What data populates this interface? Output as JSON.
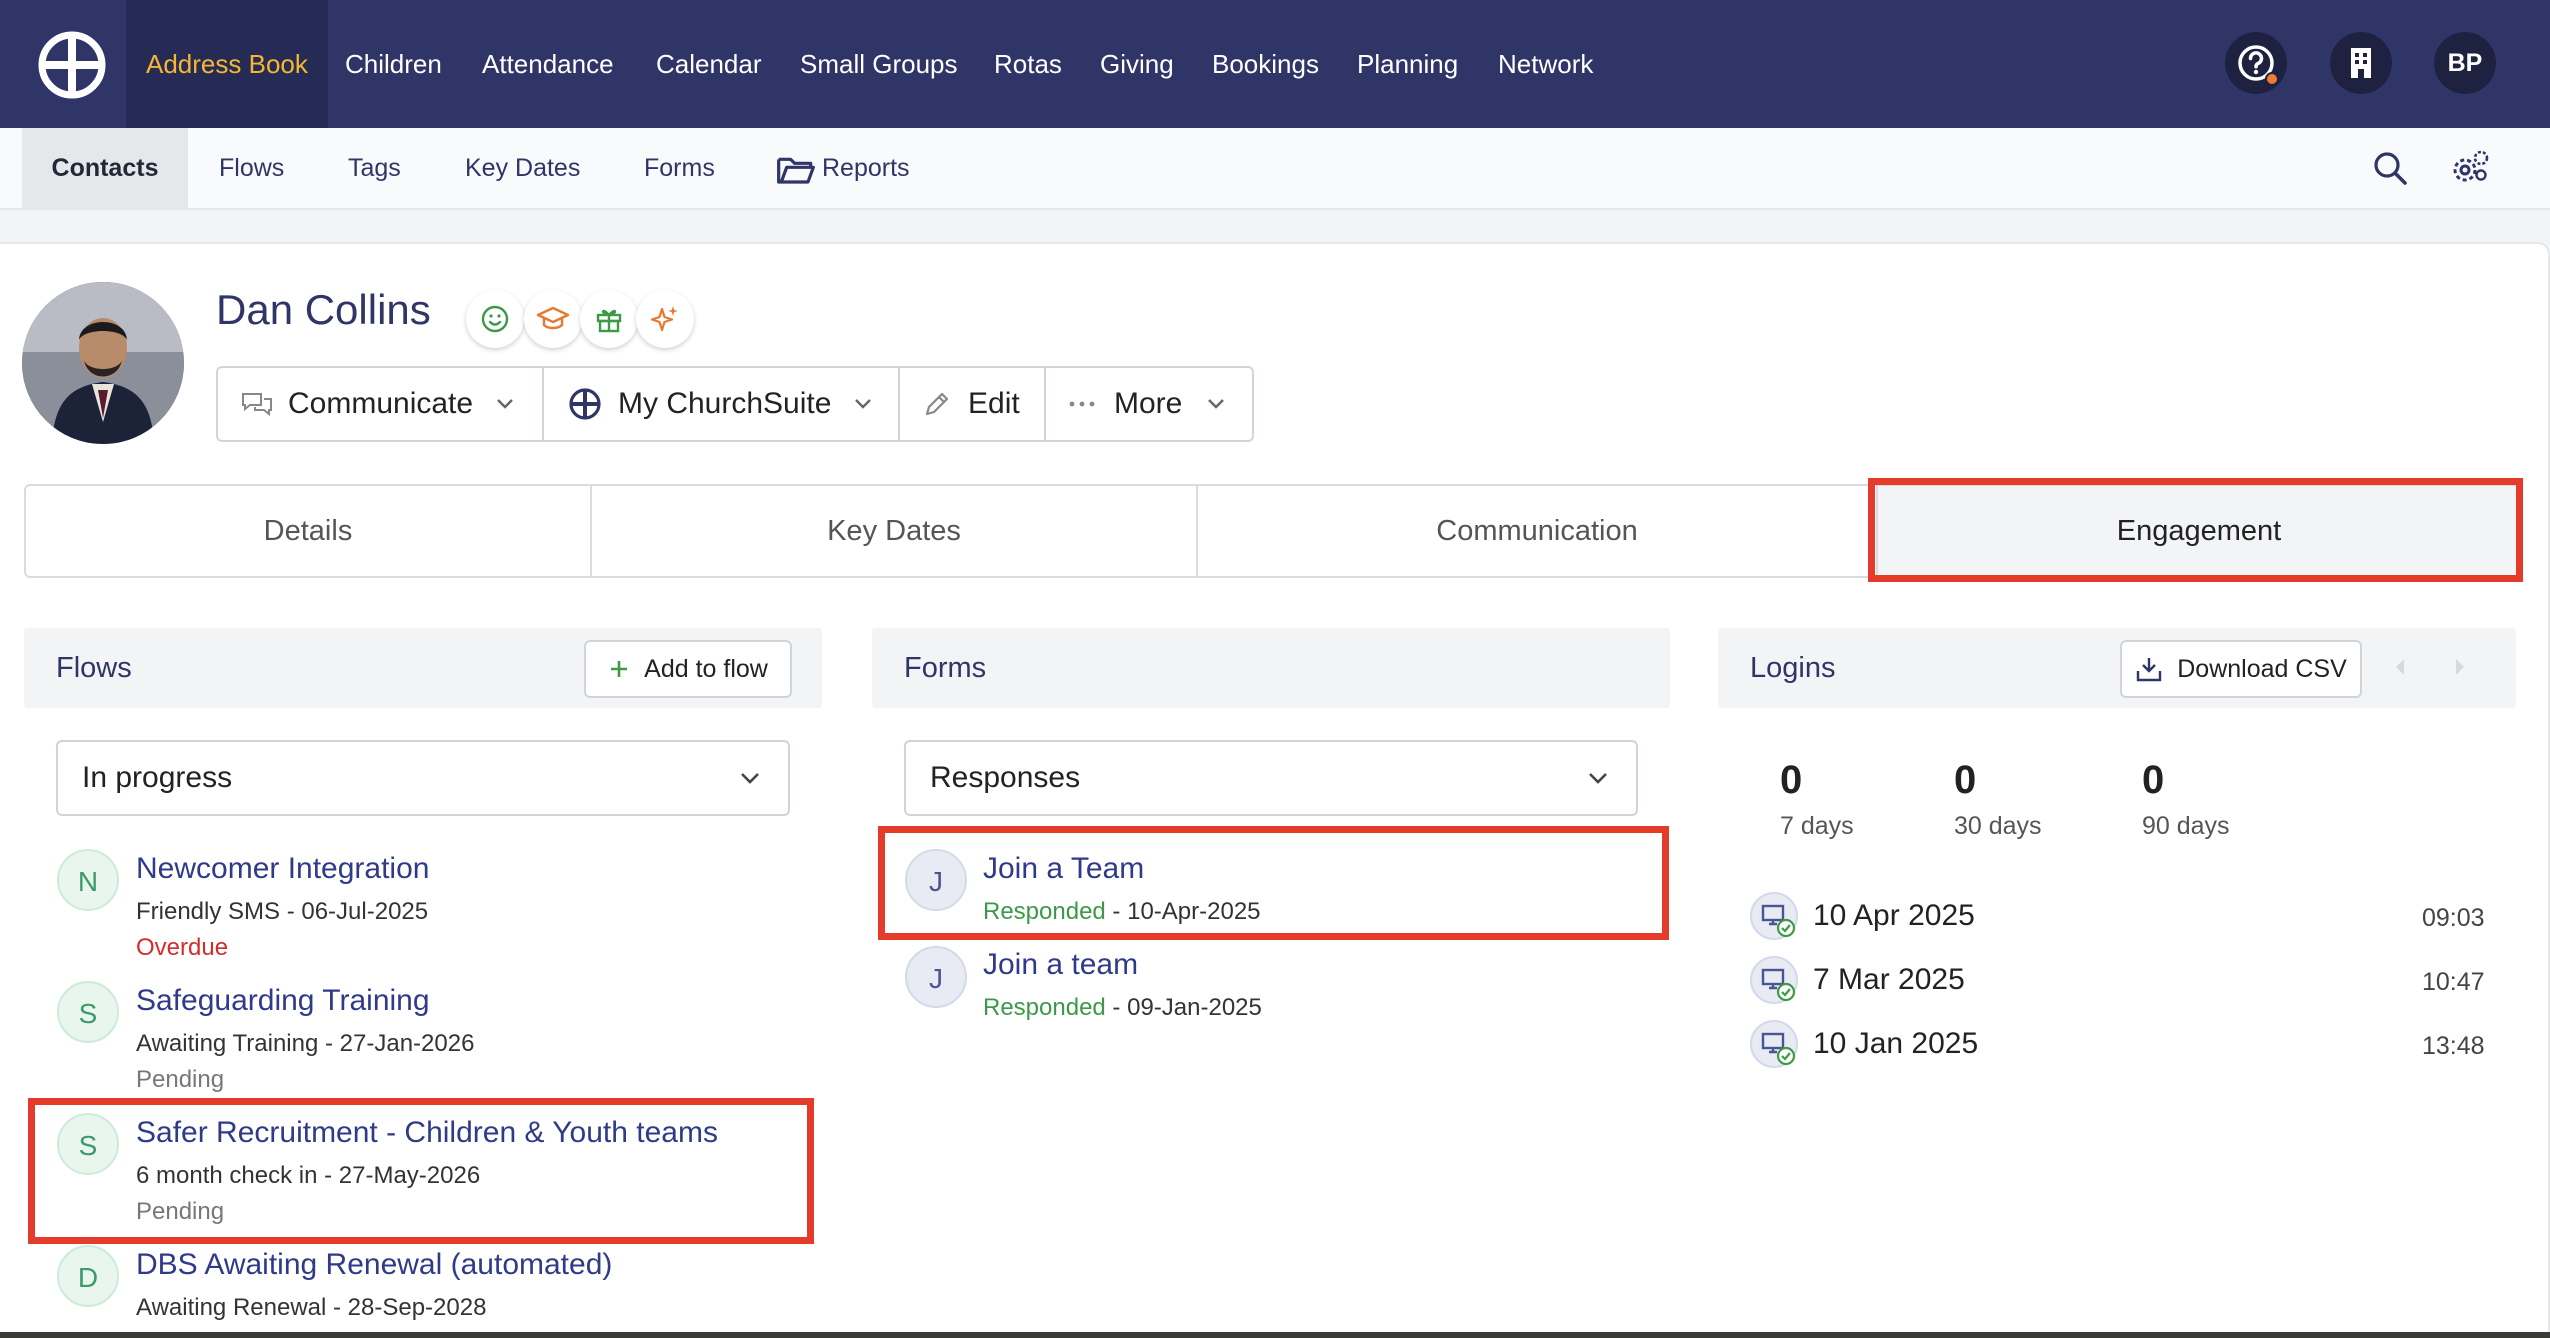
{
  "topnav": {
    "items": [
      {
        "label": "Address Book"
      },
      {
        "label": "Children"
      },
      {
        "label": "Attendance"
      },
      {
        "label": "Calendar"
      },
      {
        "label": "Small Groups"
      },
      {
        "label": "Rotas"
      },
      {
        "label": "Giving"
      },
      {
        "label": "Bookings"
      },
      {
        "label": "Planning"
      },
      {
        "label": "Network"
      }
    ],
    "active_color": "#f5b731",
    "background": "#2f3566",
    "user_initials": "BP",
    "icons": [
      "help-icon",
      "organisation-icon"
    ]
  },
  "subnav": {
    "items": [
      {
        "label": "Contacts"
      },
      {
        "label": "Flows"
      },
      {
        "label": "Tags"
      },
      {
        "label": "Key Dates"
      },
      {
        "label": "Forms"
      },
      {
        "label": "Reports"
      }
    ],
    "icons": [
      "search-icon",
      "settings-icon"
    ]
  },
  "contact": {
    "name": "Dan Collins",
    "badges": [
      "smile-icon",
      "graduation-cap-icon",
      "gift-icon",
      "sparkle-icon"
    ],
    "actions": {
      "communicate": "Communicate",
      "my_churchsuite": "My ChurchSuite",
      "edit": "Edit",
      "more": "More"
    }
  },
  "tabs": [
    {
      "label": "Details"
    },
    {
      "label": "Key Dates"
    },
    {
      "label": "Communication"
    },
    {
      "label": "Engagement"
    }
  ],
  "flows": {
    "title": "Flows",
    "add_label": "Add to flow",
    "filter": "In progress",
    "items": [
      {
        "initial": "N",
        "title": "Newcomer Integration",
        "detail": "Friendly SMS - 06-Jul-2025",
        "status": "Overdue"
      },
      {
        "initial": "S",
        "title": "Safeguarding Training",
        "detail": "Awaiting Training - 27-Jan-2026",
        "status": "Pending"
      },
      {
        "initial": "S",
        "title": "Safer Recruitment - Children & Youth teams",
        "detail": "6 month check in - 27-May-2026",
        "status": "Pending"
      },
      {
        "initial": "D",
        "title": "DBS Awaiting Renewal (automated)",
        "detail": "Awaiting Renewal - 28-Sep-2028",
        "status": ""
      }
    ]
  },
  "forms": {
    "title": "Forms",
    "filter": "Responses",
    "items": [
      {
        "initial": "J",
        "title": "Join a Team",
        "state": "Responded",
        "date": " - 10-Apr-2025"
      },
      {
        "initial": "J",
        "title": "Join a team",
        "state": "Responded",
        "date": " - 09-Jan-2025"
      }
    ]
  },
  "logins": {
    "title": "Logins",
    "download_label": "Download CSV",
    "stats": [
      {
        "value": "0",
        "label": "7 days"
      },
      {
        "value": "0",
        "label": "30 days"
      },
      {
        "value": "0",
        "label": "90 days"
      }
    ],
    "entries": [
      {
        "date": "10 Apr 2025",
        "time": "09:03"
      },
      {
        "date": "7 Mar 2025",
        "time": "10:47"
      },
      {
        "date": "10 Jan 2025",
        "time": "13:48"
      }
    ]
  },
  "colors": {
    "highlight": "#e53b2a",
    "link": "#2f3a8a",
    "success": "#3c9a46",
    "danger": "#d22c2c"
  }
}
